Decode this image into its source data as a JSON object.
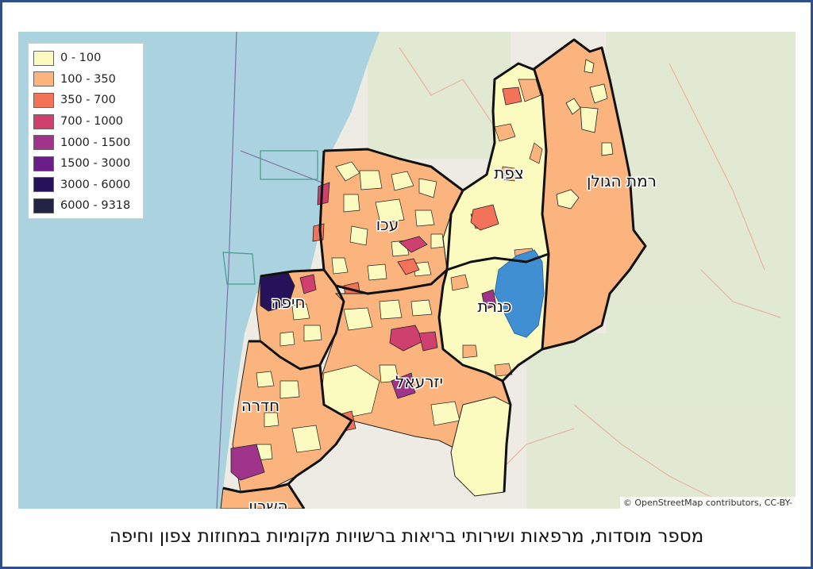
{
  "legend": {
    "items": [
      {
        "label": "0 - 100",
        "color": "#fbfbbf"
      },
      {
        "label": "100 - 350",
        "color": "#fbb47e"
      },
      {
        "label": "350 - 700",
        "color": "#f2725a"
      },
      {
        "label": "700 - 1000",
        "color": "#d0406f"
      },
      {
        "label": "1000 - 1500",
        "color": "#a0338a"
      },
      {
        "label": "1500 - 3000",
        "color": "#6b1f86"
      },
      {
        "label": "3000 - 6000",
        "color": "#26125a"
      },
      {
        "label": "6000 - 9318",
        "color": "#232445"
      }
    ]
  },
  "districts": {
    "golan": "רמת הגולן",
    "tsfat": "צפת",
    "akko": "עכו",
    "kinneret": "כנרת",
    "haifa": "חיפה",
    "yizreel": "יזרעאל",
    "hadera": "חדרה",
    "sharon": "השרון"
  },
  "attribution": "© OpenStreetMap contributors, CC-BY-",
  "caption": "מספר מוסדות, מרפאות ושירותי בריאות ברשויות מקומיות במחוזות צפון וחיפה",
  "colors": {
    "sea": "#aad3df",
    "land": "#f2efe9",
    "frame": "#2e4f8a",
    "lake": "#3f8fd2"
  }
}
